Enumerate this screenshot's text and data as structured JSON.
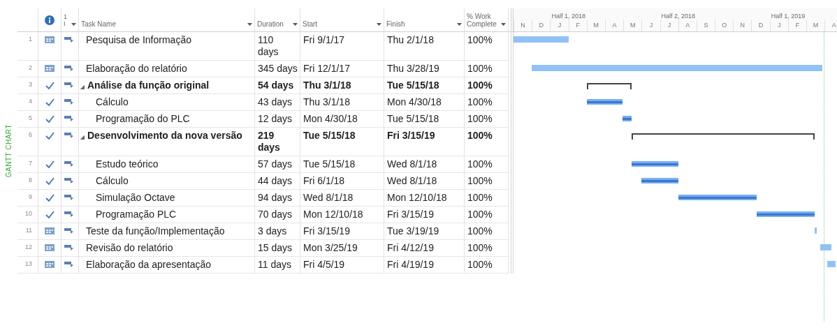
{
  "view_bar": {
    "label": "GANTT CHART"
  },
  "columns": [
    {
      "kind": "info"
    },
    {
      "kind": "mode",
      "label": "1\nI"
    },
    {
      "kind": "text",
      "label": "Task Name"
    },
    {
      "kind": "text",
      "label": "Duration"
    },
    {
      "kind": "text",
      "label": "Start"
    },
    {
      "kind": "text",
      "label": "Finish"
    },
    {
      "kind": "text",
      "label": "% Work\nComplete"
    }
  ],
  "timescale": {
    "halves": [
      "Half 1, 2018",
      "Half 2, 2018",
      "Half 1, 2019"
    ],
    "months": [
      "N",
      "D",
      "J",
      "F",
      "M",
      "A",
      "M",
      "J",
      "J",
      "A",
      "S",
      "O",
      "N",
      "D",
      "J",
      "F",
      "M",
      "A"
    ]
  },
  "rows": [
    {
      "id": "1",
      "complete": false,
      "name": "Pesquisa de Informação",
      "duration": "110\ndays",
      "start": "Fri 9/1/17",
      "finish": "Thu 2/1/18",
      "work": "100%"
    },
    {
      "id": "2",
      "complete": false,
      "name": "Elaboração do relatório",
      "duration": "345 days",
      "start": "Fri 12/1/17",
      "finish": "Thu 3/28/19",
      "work": "100%"
    },
    {
      "id": "3",
      "complete": true,
      "name": "Análise da função original",
      "duration": "54 days",
      "start": "Thu 3/1/18",
      "finish": "Tue 5/15/18",
      "work": "100%",
      "expanded": true,
      "children": [
        {
          "id": "4",
          "complete": true,
          "name": "Cálculo",
          "duration": "43 days",
          "start": "Thu 3/1/18",
          "finish": "Mon 4/30/18",
          "work": "100%"
        },
        {
          "id": "5",
          "complete": true,
          "name": "Programação do PLC",
          "duration": "12 days",
          "start": "Mon 4/30/18",
          "finish": "Tue 5/15/18",
          "work": "100%"
        }
      ]
    },
    {
      "id": "6",
      "complete": true,
      "name": "Desenvolvimento da nova versão",
      "duration": "219\ndays",
      "start": "Tue 5/15/18",
      "finish": "Fri 3/15/19",
      "work": "100%",
      "expanded": true,
      "children": [
        {
          "id": "7",
          "complete": true,
          "name": "Estudo teórico",
          "duration": "57 days",
          "start": "Tue 5/15/18",
          "finish": "Wed 8/1/18",
          "work": "100%"
        },
        {
          "id": "8",
          "complete": true,
          "name": "Cálculo",
          "duration": "44 days",
          "start": "Fri 6/1/18",
          "finish": "Wed 8/1/18",
          "work": "100%"
        },
        {
          "id": "9",
          "complete": true,
          "name": "Simulação Octave",
          "duration": "94 days",
          "start": "Wed 8/1/18",
          "finish": "Mon 12/10/18",
          "work": "100%"
        },
        {
          "id": "10",
          "complete": true,
          "name": "Programação PLC",
          "duration": "70 days",
          "start": "Mon 12/10/18",
          "finish": "Fri 3/15/19",
          "work": "100%"
        }
      ]
    },
    {
      "id": "11",
      "complete": false,
      "name": "Teste da função/Implementação",
      "duration": "3 days",
      "start": "Fri 3/15/19",
      "finish": "Tue 3/19/19",
      "work": "100%"
    },
    {
      "id": "12",
      "complete": false,
      "name": "Revisão do relatório",
      "duration": "15 days",
      "start": "Mon 3/25/19",
      "finish": "Fri 4/12/19",
      "work": "100%"
    },
    {
      "id": "13",
      "complete": false,
      "name": "Elaboração da apresentação",
      "duration": "11 days",
      "start": "Fri 4/5/19",
      "finish": "Fri 4/19/19",
      "work": "100%"
    }
  ]
}
